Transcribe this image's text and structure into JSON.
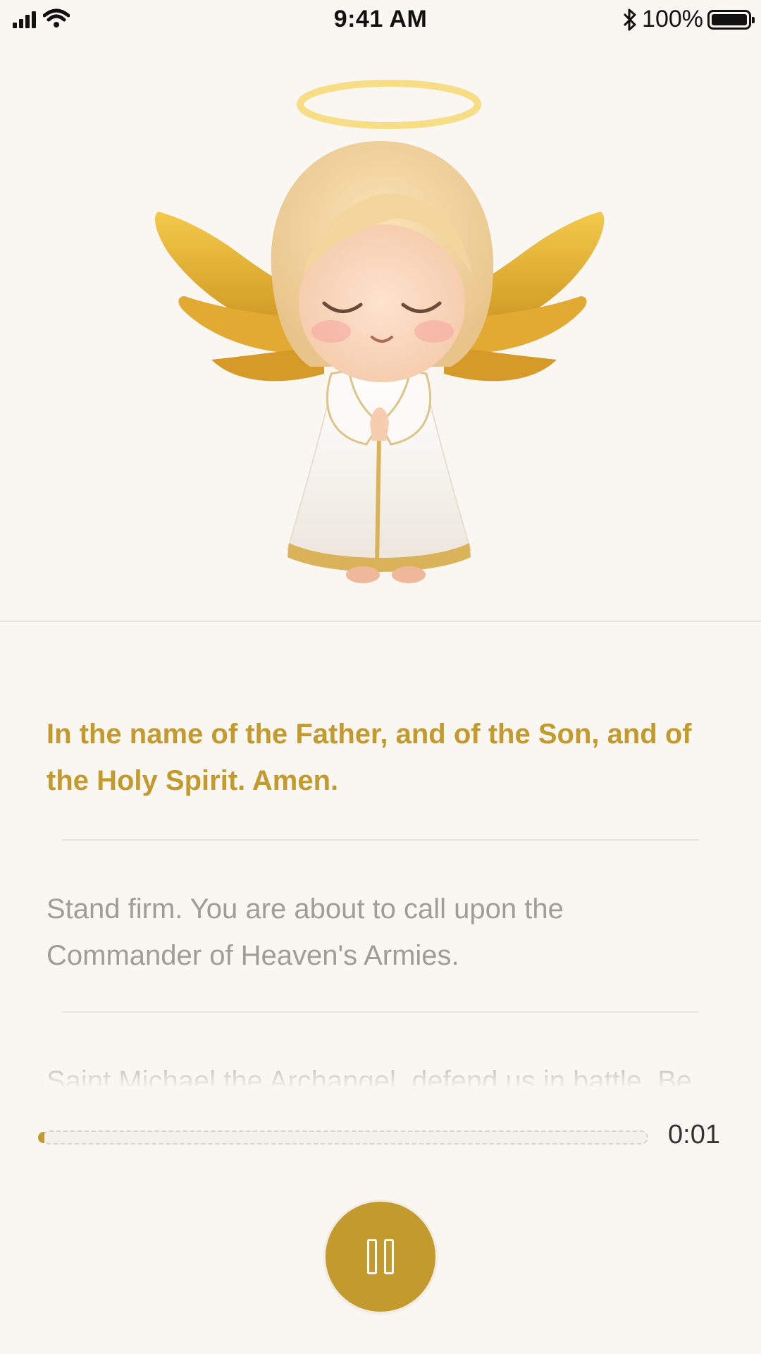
{
  "status_bar": {
    "time": "9:41 AM",
    "battery_percent": "100%",
    "icons": [
      "signal-icon",
      "wifi-icon",
      "bluetooth-icon",
      "battery-icon"
    ]
  },
  "hero": {
    "image": "praying-angel-illustration"
  },
  "prayer": {
    "current_line": "In the name of the Father, and of the Son, and of the Holy Spirit. Amen.",
    "next_line": "Stand firm. You are about to call upon the Commander of Heaven's Armies.",
    "upcoming_line": "Saint Michael the Archangel, defend us in battle. Be"
  },
  "player": {
    "elapsed": "0:01",
    "progress_fraction": 0.01,
    "control_icon": "pause-icon"
  },
  "colors": {
    "accent": "#c39a2e",
    "background": "#faf7f3",
    "muted_text": "#a09c98"
  }
}
